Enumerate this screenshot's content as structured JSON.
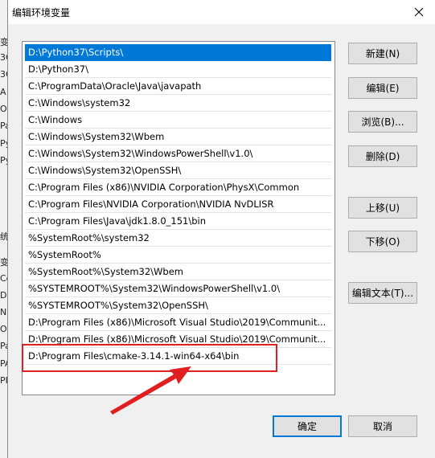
{
  "dialog": {
    "title": "编辑环境变量"
  },
  "background_window": {
    "fragments": [
      "变",
      "3C",
      "3C",
      "A",
      "O",
      "Pa",
      "Py",
      "Py",
      "统",
      "变",
      "Co",
      "D",
      "N",
      "O",
      "Pa",
      "PA",
      "PF"
    ]
  },
  "path_list": {
    "items": [
      "D:\\Python37\\Scripts\\",
      "D:\\Python37\\",
      "C:\\ProgramData\\Oracle\\Java\\javapath",
      "C:\\Windows\\system32",
      "C:\\Windows",
      "C:\\Windows\\System32\\Wbem",
      "C:\\Windows\\System32\\WindowsPowerShell\\v1.0\\",
      "C:\\Windows\\System32\\OpenSSH\\",
      "C:\\Program Files (x86)\\NVIDIA Corporation\\PhysX\\Common",
      "C:\\Program Files\\NVIDIA Corporation\\NVIDIA NvDLISR",
      "C:\\Program Files\\Java\\jdk1.8.0_151\\bin",
      "%SystemRoot%\\system32",
      "%SystemRoot%",
      "%SystemRoot%\\System32\\Wbem",
      "%SYSTEMROOT%\\System32\\WindowsPowerShell\\v1.0\\",
      "%SYSTEMROOT%\\System32\\OpenSSH\\",
      "D:\\Program Files (x86)\\Microsoft Visual Studio\\2019\\Communit...",
      "D:\\Program Files (x86)\\Microsoft Visual Studio\\2019\\Communit...",
      "D:\\Program Files\\cmake-3.14.1-win64-x64\\bin"
    ],
    "selected_index": 0
  },
  "buttons": {
    "new": "新建(N)",
    "edit": "编辑(E)",
    "browse": "浏览(B)...",
    "delete": "删除(D)",
    "move_up": "上移(U)",
    "move_down": "下移(O)",
    "edit_text": "编辑文本(T)...",
    "ok": "确定",
    "cancel": "取消"
  },
  "icons": {
    "close": "close-icon"
  },
  "colors": {
    "selection": "#0078d7",
    "annotation": "#e02020",
    "dialog_bg": "#f0f0f0"
  }
}
